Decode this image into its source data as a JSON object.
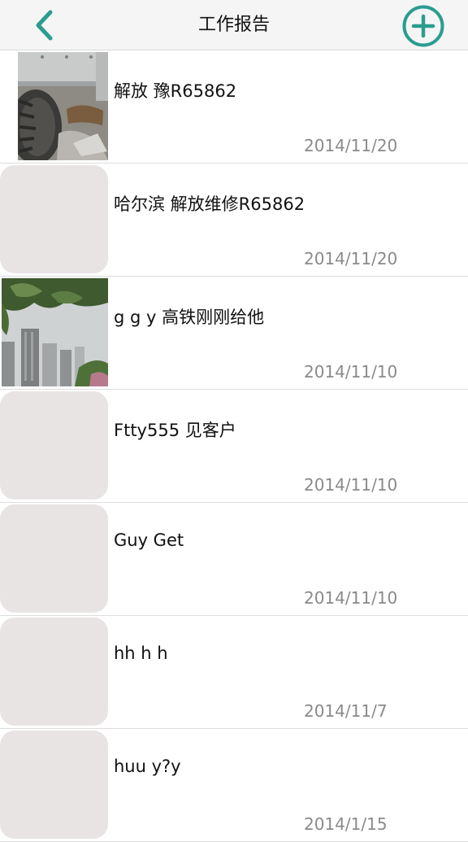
{
  "header": {
    "title": "工作报告",
    "back_icon": "chevron-left-icon",
    "add_icon": "plus-circle-icon",
    "accent_color": "#2a9d8f"
  },
  "reports": [
    {
      "title": "解放 豫R65862",
      "date": "2014/11/20",
      "thumbnail": "photo-truck-tire"
    },
    {
      "title": " 哈尔滨 解放维修R65862",
      "date": "2014/11/20",
      "thumbnail": "placeholder"
    },
    {
      "title": "g g y 高铁刚刚给他",
      "date": "2014/11/10",
      "thumbnail": "photo-trees-buildings"
    },
    {
      "title": "Ftty555 见客户",
      "date": "2014/11/10",
      "thumbnail": "placeholder"
    },
    {
      "title": "Guy Get",
      "date": "2014/11/10",
      "thumbnail": "placeholder"
    },
    {
      "title": "hh h h",
      "date": "2014/11/7",
      "thumbnail": "placeholder"
    },
    {
      "title": "huu y?y",
      "date": "2014/1/15",
      "thumbnail": "placeholder"
    }
  ]
}
